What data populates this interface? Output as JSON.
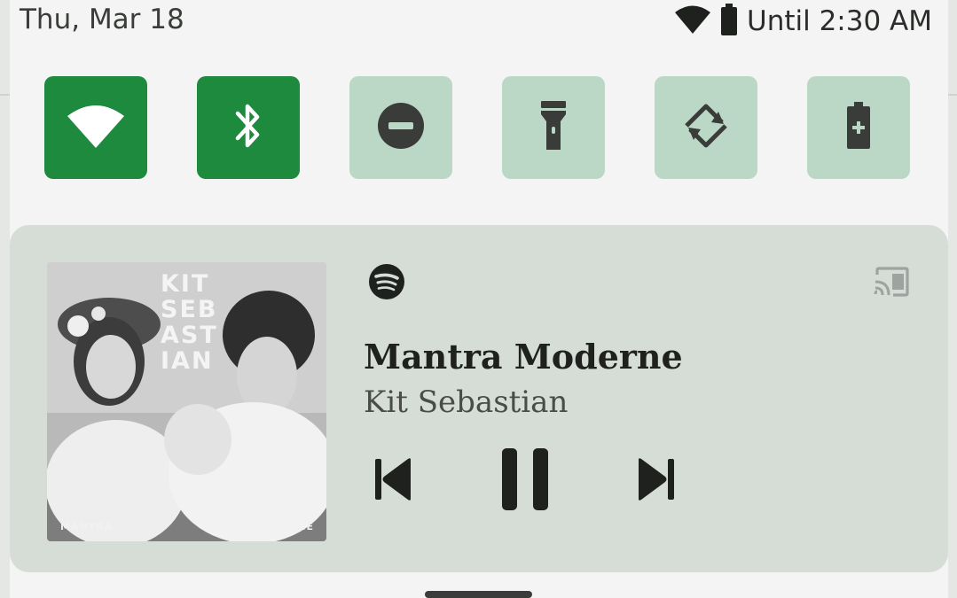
{
  "status_bar": {
    "date": "Thu, Mar 18",
    "icons": [
      "wifi-icon",
      "battery-icon"
    ],
    "alarm_text": "Until 2:30 AM"
  },
  "quick_settings": {
    "tiles": [
      {
        "name": "wifi",
        "icon": "wifi-icon",
        "state": "on"
      },
      {
        "name": "bluetooth",
        "icon": "bluetooth-icon",
        "state": "on"
      },
      {
        "name": "do-not-disturb",
        "icon": "do-not-disturb-icon",
        "state": "off"
      },
      {
        "name": "flashlight",
        "icon": "flashlight-icon",
        "state": "off"
      },
      {
        "name": "auto-rotate",
        "icon": "auto-rotate-icon",
        "state": "off"
      },
      {
        "name": "battery-saver",
        "icon": "battery-saver-icon",
        "state": "off"
      }
    ],
    "colors": {
      "on": "#1d8a3e",
      "off": "#bad8c5"
    }
  },
  "media": {
    "app_icon": "spotify-icon",
    "cast_icon": "cast-icon",
    "album_art": {
      "title_lines": [
        "KIT",
        "SEB",
        "AST",
        "IAN"
      ],
      "bottom_left": "MANTRA",
      "bottom_right": "MODERNE"
    },
    "song_title": "Mantra Moderne",
    "artist": "Kit Sebastian",
    "controls": [
      "skip-previous-icon",
      "pause-icon",
      "skip-next-icon"
    ]
  }
}
